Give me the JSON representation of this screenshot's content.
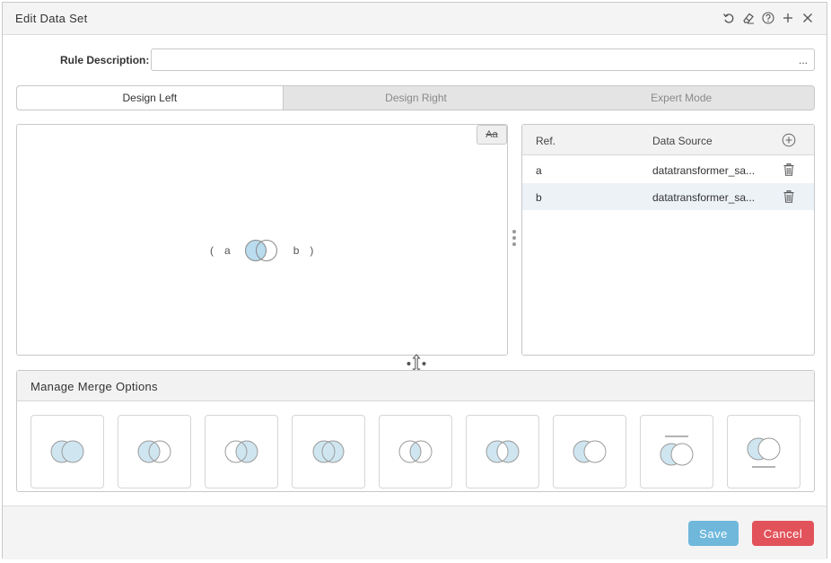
{
  "dialog": {
    "title": "Edit Data Set",
    "title_icons": [
      "undo-icon",
      "eraser-icon",
      "help-icon",
      "plus-icon",
      "close-icon"
    ]
  },
  "rule": {
    "label": "Rule Description:",
    "value": "",
    "ellipsis": "..."
  },
  "tabs": [
    {
      "label": "Design Left",
      "active": true
    },
    {
      "label": "Design Right",
      "active": false
    },
    {
      "label": "Expert Mode",
      "active": false
    }
  ],
  "design": {
    "aa_label": "Aa",
    "expression": {
      "open": "(",
      "left": "a",
      "right": "b",
      "close": ")"
    }
  },
  "references": {
    "headers": {
      "ref": "Ref.",
      "source": "Data Source"
    },
    "rows": [
      {
        "ref": "a",
        "source": "datatransformer_sa..."
      },
      {
        "ref": "b",
        "source": "datatransformer_sa..."
      }
    ]
  },
  "merge": {
    "title": "Manage Merge Options",
    "options": [
      "full-outer",
      "left-join",
      "right-join",
      "union",
      "inner-join",
      "exclusive",
      "left-only",
      "top-filtered",
      "bottom-filtered"
    ]
  },
  "footer": {
    "save_label": "Save",
    "cancel_label": "Cancel"
  },
  "colors": {
    "fill": "#cfe6f1",
    "stroke": "#9a9a9a",
    "save": "#6fb8dc",
    "cancel": "#e2525a"
  }
}
